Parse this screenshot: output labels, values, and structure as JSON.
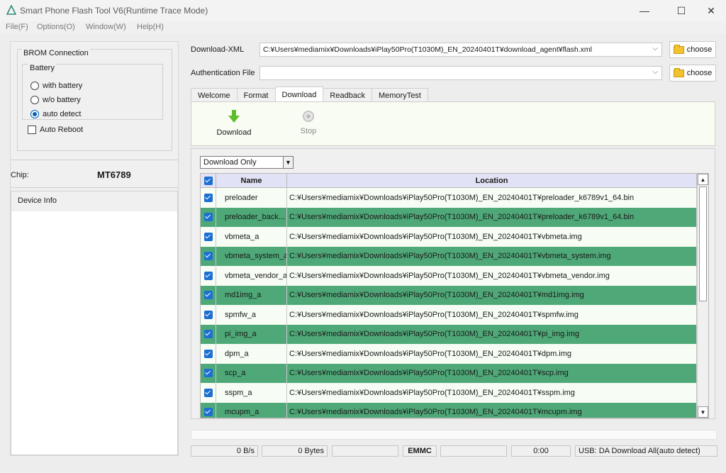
{
  "window": {
    "title": "Smart Phone Flash Tool V6(Runtime Trace Mode)",
    "minimize": "—",
    "maximize": "☐",
    "close": "✕"
  },
  "menu": [
    "File(F)",
    "Options(O)",
    "Window(W)",
    "Help(H)"
  ],
  "left": {
    "brom_title": "BROM Connection",
    "battery_title": "Battery",
    "battery_options": [
      {
        "label": "with battery",
        "selected": false
      },
      {
        "label": "w/o battery",
        "selected": false
      },
      {
        "label": "auto detect",
        "selected": true
      }
    ],
    "auto_reboot": "Auto Reboot",
    "chip_label": "Chip:",
    "chip_value": "MT6789",
    "device_info_title": "Device Info"
  },
  "form": {
    "download_xml_label": "Download-XML",
    "download_xml_value": "C:¥Users¥mediamix¥Downloads¥iPlay50Pro(T1030M)_EN_20240401T¥download_agent¥flash.xml",
    "auth_label": "Authentication File",
    "auth_value": "",
    "choose_label": "choose"
  },
  "tabs": [
    {
      "label": "Welcome",
      "active": false
    },
    {
      "label": "Format",
      "active": false
    },
    {
      "label": "Download",
      "active": true
    },
    {
      "label": "Readback",
      "active": false
    },
    {
      "label": "MemoryTest",
      "active": false
    }
  ],
  "toolbar": {
    "download": "Download",
    "stop": "Stop"
  },
  "list": {
    "mode": "Download Only",
    "col_name": "Name",
    "col_location": "Location",
    "rows": [
      {
        "name": "preloader",
        "location": "C:¥Users¥mediamix¥Downloads¥iPlay50Pro(T1030M)_EN_20240401T¥preloader_k6789v1_64.bin"
      },
      {
        "name": "preloader_back...",
        "location": "C:¥Users¥mediamix¥Downloads¥iPlay50Pro(T1030M)_EN_20240401T¥preloader_k6789v1_64.bin"
      },
      {
        "name": "vbmeta_a",
        "location": "C:¥Users¥mediamix¥Downloads¥iPlay50Pro(T1030M)_EN_20240401T¥vbmeta.img"
      },
      {
        "name": "vbmeta_system_a",
        "location": "C:¥Users¥mediamix¥Downloads¥iPlay50Pro(T1030M)_EN_20240401T¥vbmeta_system.img"
      },
      {
        "name": "vbmeta_vendor_a",
        "location": "C:¥Users¥mediamix¥Downloads¥iPlay50Pro(T1030M)_EN_20240401T¥vbmeta_vendor.img"
      },
      {
        "name": "md1img_a",
        "location": "C:¥Users¥mediamix¥Downloads¥iPlay50Pro(T1030M)_EN_20240401T¥md1img.img"
      },
      {
        "name": "spmfw_a",
        "location": "C:¥Users¥mediamix¥Downloads¥iPlay50Pro(T1030M)_EN_20240401T¥spmfw.img"
      },
      {
        "name": "pi_img_a",
        "location": "C:¥Users¥mediamix¥Downloads¥iPlay50Pro(T1030M)_EN_20240401T¥pi_img.img"
      },
      {
        "name": "dpm_a",
        "location": "C:¥Users¥mediamix¥Downloads¥iPlay50Pro(T1030M)_EN_20240401T¥dpm.img"
      },
      {
        "name": "scp_a",
        "location": "C:¥Users¥mediamix¥Downloads¥iPlay50Pro(T1030M)_EN_20240401T¥scp.img"
      },
      {
        "name": "sspm_a",
        "location": "C:¥Users¥mediamix¥Downloads¥iPlay50Pro(T1030M)_EN_20240401T¥sspm.img"
      },
      {
        "name": "mcupm_a",
        "location": "C:¥Users¥mediamix¥Downloads¥iPlay50Pro(T1030M)_EN_20240401T¥mcupm.img"
      }
    ]
  },
  "status": {
    "speed": "0 B/s",
    "bytes": "0 Bytes",
    "storage": "EMMC",
    "time": "0:00",
    "usb": "USB: DA Download All(auto detect)"
  },
  "colors": {
    "row_dark": "#4fa878",
    "row_light": "#f7fdf4",
    "header": "#e2e2f6",
    "check": "#1d6fd1"
  }
}
